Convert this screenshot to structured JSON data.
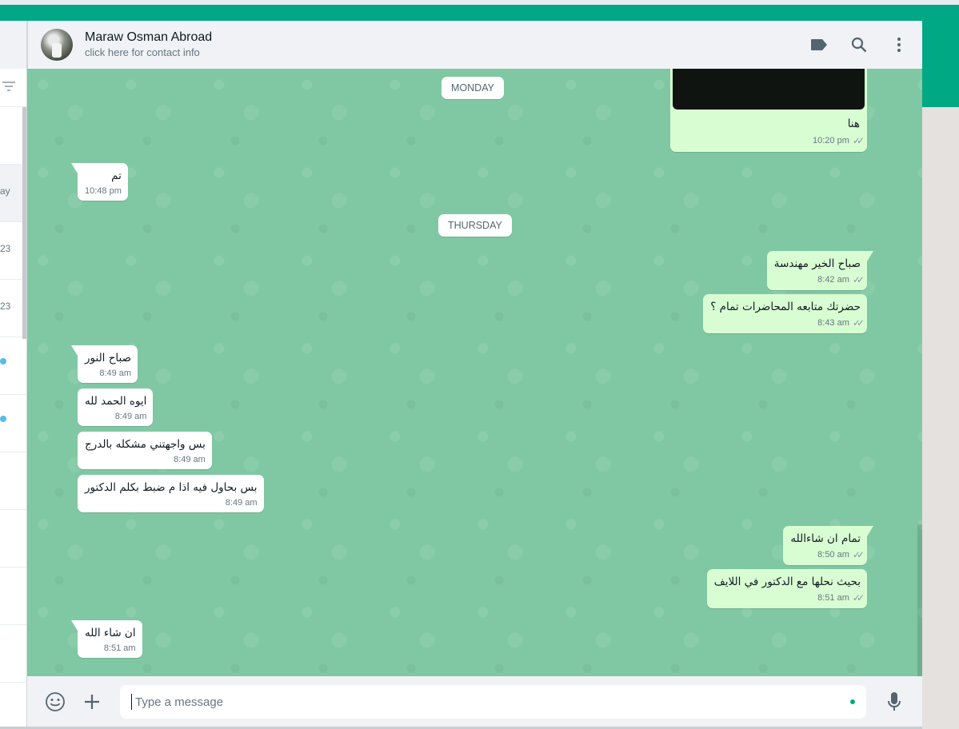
{
  "sidebar": {
    "rows": [
      {
        "text": ""
      },
      {
        "text": "ay"
      },
      {
        "text": "23"
      },
      {
        "text": "23"
      },
      {
        "text": ""
      },
      {
        "text": ""
      },
      {
        "text": ""
      },
      {
        "text": ""
      },
      {
        "text": ""
      },
      {
        "text": ""
      }
    ]
  },
  "header": {
    "name": "Maraw Osman Abroad",
    "subtitle": "click here for contact info",
    "icons": [
      "label-icon",
      "search-icon",
      "menu-icon"
    ]
  },
  "day_labels": {
    "first": "MONDAY",
    "second": "THURSDAY"
  },
  "messages": [
    {
      "dir": "out",
      "type": "image",
      "text": "هنا",
      "time": "10:20 pm"
    },
    {
      "dir": "in",
      "text": "تم",
      "time": "10:48 pm"
    },
    {
      "dir": "out",
      "text": "صباح الخير مهندسة",
      "time": "8:42 am"
    },
    {
      "dir": "out",
      "text": "حضرتك متابعه المحاضرات تمام ؟",
      "time": "8:43 am"
    },
    {
      "dir": "in",
      "text": "صباح النور",
      "time": "8:49 am"
    },
    {
      "dir": "in",
      "text": "ايوه الحمد لله",
      "time": "8:49 am"
    },
    {
      "dir": "in",
      "text": "بس واجهتني مشكله بالدرج",
      "time": "8:49 am"
    },
    {
      "dir": "in",
      "text": "بس بحاول فيه اذا م ضبط بكلم الدكتور",
      "time": "8:49 am"
    },
    {
      "dir": "out",
      "text": "تمام ان شاءالله",
      "time": "8:50 am"
    },
    {
      "dir": "out",
      "text": "بحيث نحلها مع الدكتور في اللايف",
      "time": "8:51 am"
    },
    {
      "dir": "in",
      "text": "ان شاء الله",
      "time": "8:51 am"
    }
  ],
  "composer": {
    "placeholder": "Type a message",
    "icons": [
      "emoji-icon",
      "attach-plus-icon",
      "microphone-icon"
    ]
  },
  "colors": {
    "accent": "#00a884",
    "chat_background": "#7fc8a3",
    "outgoing_bubble": "#d9fdd3",
    "incoming_bubble": "#ffffff",
    "header_background": "#f0f2f5"
  }
}
